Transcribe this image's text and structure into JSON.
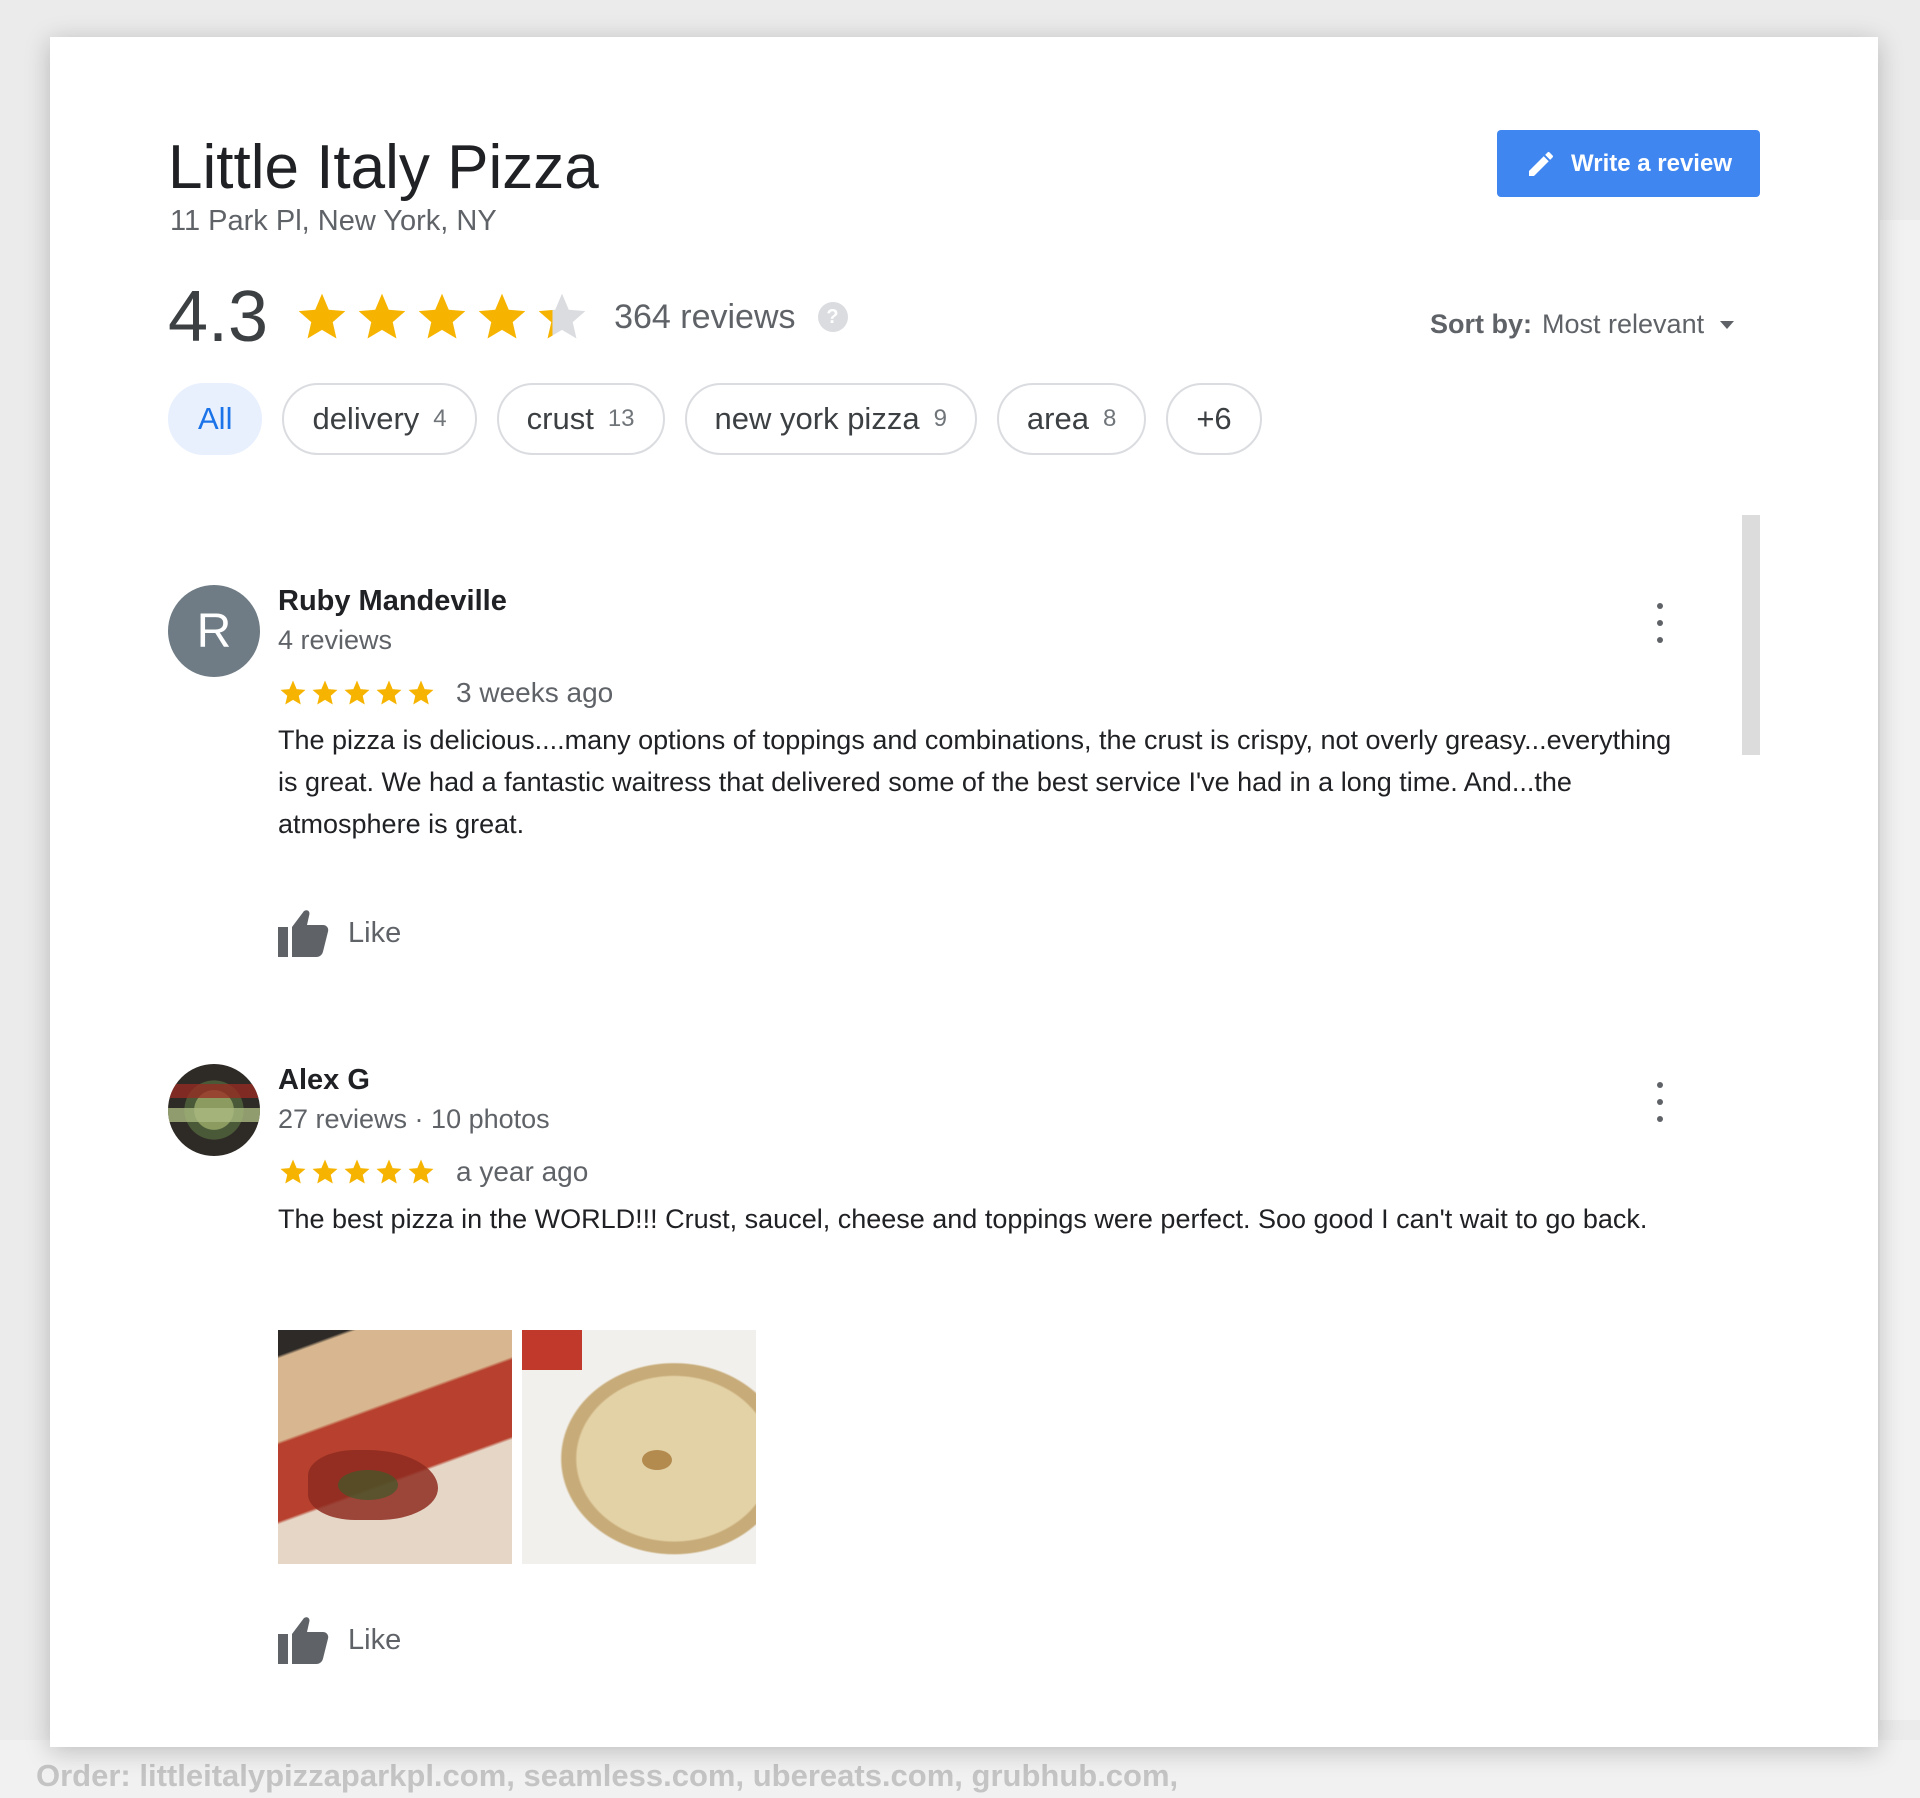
{
  "place": {
    "title": "Little Italy Pizza",
    "address": "11 Park Pl, New York, NY",
    "rating": "4.3",
    "rating_value": 4.3,
    "review_count": "364 reviews"
  },
  "actions": {
    "write_review": "Write a review"
  },
  "sort": {
    "label": "Sort by:",
    "value": "Most relevant"
  },
  "chips": [
    {
      "label": "All",
      "count": "",
      "active": true
    },
    {
      "label": "delivery",
      "count": "4"
    },
    {
      "label": "crust",
      "count": "13"
    },
    {
      "label": "new york pizza",
      "count": "9"
    },
    {
      "label": "area",
      "count": "8"
    },
    {
      "label": "+6",
      "count": ""
    }
  ],
  "reviews": [
    {
      "name": "Ruby Mandeville",
      "avatar_letter": "R",
      "meta": "4 reviews",
      "stars": 5,
      "date": "3 weeks ago",
      "text": "The pizza is delicious....many options of toppings and combinations, the crust is crispy, not overly greasy...everything is great. We had a fantastic waitress that delivered some of the best service I've had in a long time. And...the atmosphere is great.",
      "like_label": "Like"
    },
    {
      "name": "Alex G",
      "meta": "27 reviews · 10 photos",
      "stars": 5,
      "date": "a year ago",
      "text": "The best pizza in the WORLD!!! Crust, saucel, cheese and toppings were perfect.  Soo good I can't wait to go back.",
      "like_label": "Like"
    }
  ],
  "background": {
    "footer": "Order: littleitalypizzaparkpl.com, seamless.com, ubereats.com, grubhub.com,"
  },
  "colors": {
    "star": "#f6b400",
    "star_empty": "#dadce0",
    "accent": "#3f86f0"
  },
  "icons": {
    "write": "pencil-icon",
    "help": "help-icon",
    "like": "thumbs-up-icon",
    "more": "more-vert-icon",
    "sort": "caret-down-icon"
  }
}
